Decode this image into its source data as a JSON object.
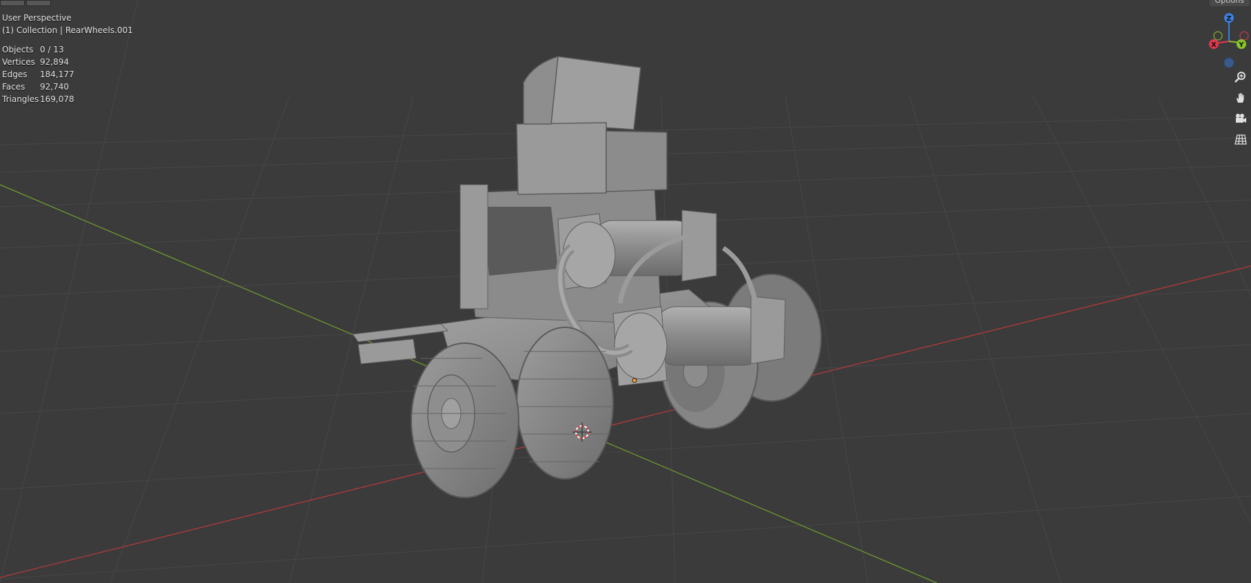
{
  "viewport": {
    "view_title": "User Perspective",
    "collection_line": "(1) Collection | RearWheels.001",
    "options_label": "Options"
  },
  "stats": {
    "objects": {
      "label": "Objects",
      "value": "0 / 13"
    },
    "vertices": {
      "label": "Vertices",
      "value": "92,894"
    },
    "edges": {
      "label": "Edges",
      "value": "184,177"
    },
    "faces": {
      "label": "Faces",
      "value": "92,740"
    },
    "triangles": {
      "label": "Triangles",
      "value": "169,078"
    }
  },
  "gizmo": {
    "z_label": "Z",
    "x_label": "X",
    "y_label": "Y",
    "colors": {
      "x": "#e2384f",
      "y": "#86c42b",
      "z": "#3c7fdd"
    }
  },
  "nav_tools": [
    {
      "name": "zoom-icon"
    },
    {
      "name": "hand-pan-icon"
    },
    {
      "name": "camera-view-icon"
    },
    {
      "name": "ortho-grid-icon"
    }
  ],
  "colors": {
    "background": "#3b3b3b",
    "grid": "#454545",
    "x_axis": "#b43a3a",
    "y_axis": "#6f9a2f",
    "model": "#8f8f8f"
  }
}
